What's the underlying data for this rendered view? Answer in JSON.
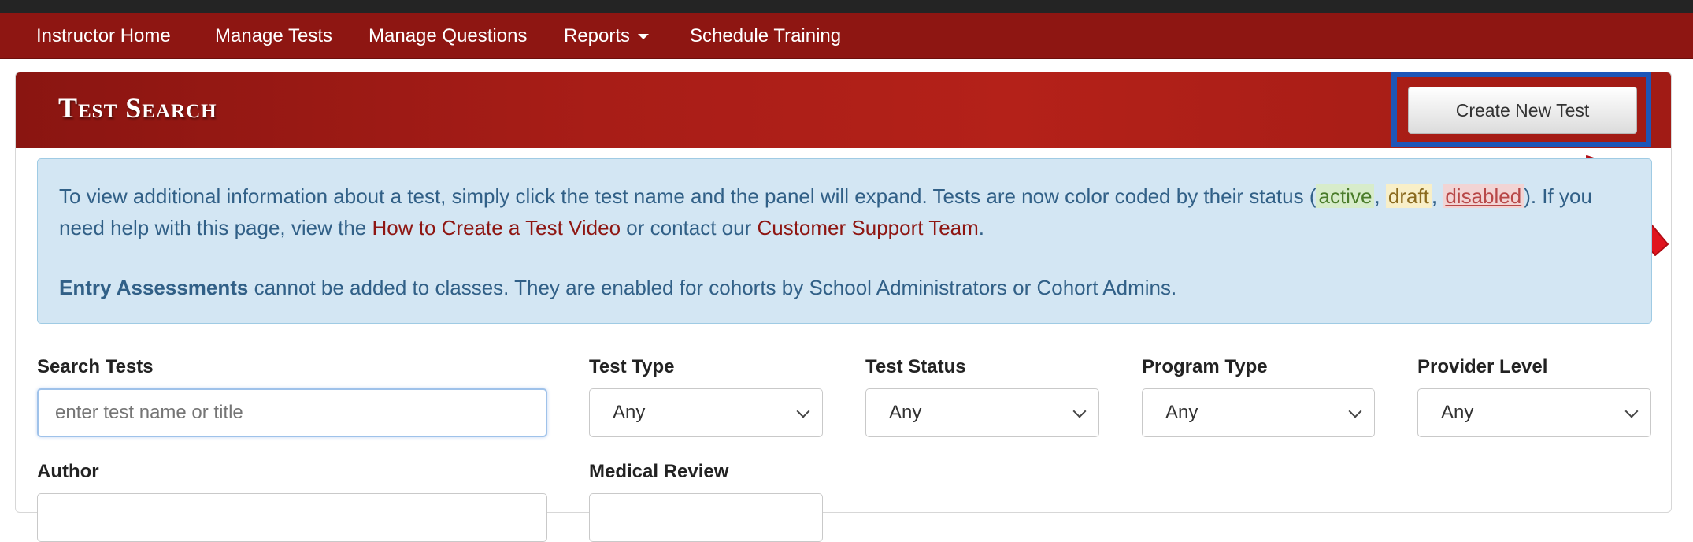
{
  "nav": {
    "items": [
      {
        "label": "Instructor Home"
      },
      {
        "label": "Manage Tests"
      },
      {
        "label": "Manage Questions"
      },
      {
        "label": "Reports"
      },
      {
        "label": "Schedule Training"
      }
    ]
  },
  "panel": {
    "title": "Test Search",
    "create_button": "Create New Test"
  },
  "info": {
    "p1_a": "To view additional information about a test, simply click the test name and the panel will expand. Tests are now color coded by their status (",
    "status_active": "active",
    "sep1": ", ",
    "status_draft": "draft",
    "sep2": ", ",
    "status_disabled": "disabled",
    "p1_b": "). If you need help with this page, view the ",
    "video_link": "How to Create a Test Video",
    "p1_c": " or contact our ",
    "support_link": "Customer Support Team",
    "p1_d": ".",
    "p2_bold": "Entry Assessments",
    "p2_rest": " cannot be added to classes. They are enabled for cohorts by School Administrators or Cohort Admins."
  },
  "filters": {
    "search_label": "Search Tests",
    "search_placeholder": "enter test name or title",
    "search_value": "",
    "test_type_label": "Test Type",
    "test_type_value": "Any",
    "test_status_label": "Test Status",
    "test_status_value": "Any",
    "program_type_label": "Program Type",
    "program_type_value": "Any",
    "provider_level_label": "Provider Level",
    "provider_level_value": "Any",
    "author_label": "Author",
    "medical_review_label": "Medical Review"
  },
  "colors": {
    "nav_bg": "#8e1612",
    "header_bg": "#a81d17",
    "info_bg": "#d3e6f3",
    "highlight_box": "#1d56b8",
    "arrow": "#e0141e"
  }
}
